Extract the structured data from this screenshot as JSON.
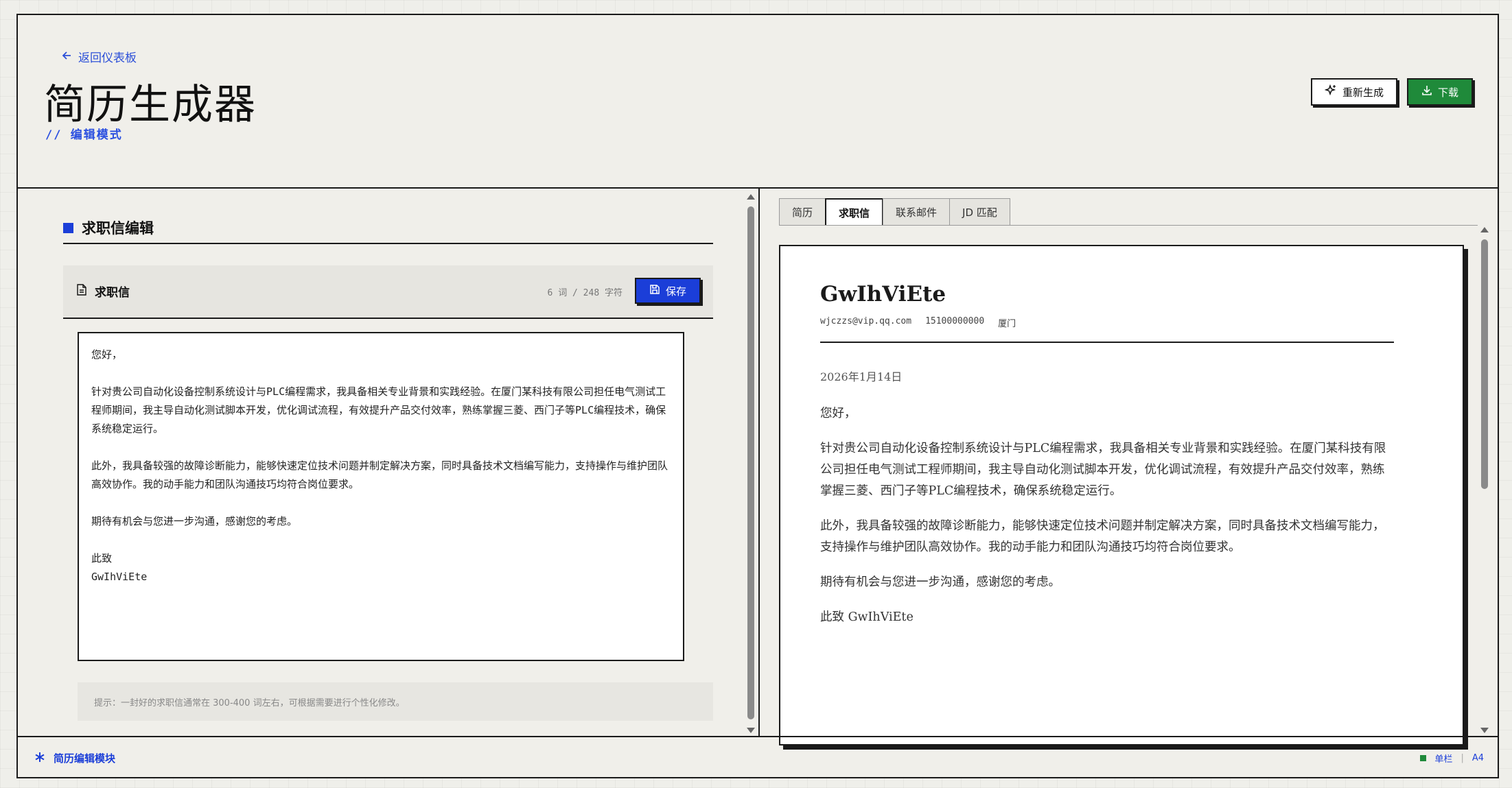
{
  "header": {
    "back_label": "返回仪表板",
    "title": "简历生成器",
    "subtitle": "// 编辑模式",
    "regen_label": "重新生成",
    "download_label": "下载"
  },
  "editor": {
    "section_title": "求职信编辑",
    "toolbar_label": "求职信",
    "count": "6 词 / 248 字符",
    "save_label": "保存",
    "lines": {
      "greeting": "您好，",
      "p1": "针对贵公司自动化设备控制系统设计与PLC编程需求，我具备相关专业背景和实践经验。在厦门某科技有限公司担任电气测试工程师期间，我主导自动化测试脚本开发，优化调试流程，有效提升产品交付效率，熟练掌握三菱、西门子等PLC编程技术，确保系统稳定运行。",
      "p2": "此外，我具备较强的故障诊断能力，能够快速定位技术问题并制定解决方案，同时具备技术文档编写能力，支持操作与维护团队高效协作。我的动手能力和团队沟通技巧均符合岗位要求。",
      "p3": "期待有机会与您进一步沟通，感谢您的考虑。",
      "closing": "此致",
      "signature": "GwIhViEte"
    },
    "hint": "提示：一封好的求职信通常在 300-400 词左右，可根据需要进行个性化修改。"
  },
  "tabs": [
    "简历",
    "求职信",
    "联系邮件",
    "JD 匹配"
  ],
  "preview": {
    "name": "GwIhViEte",
    "email": "wjczzs@vip.qq.com",
    "phone": "15100000000",
    "city": "厦门",
    "date": "2026年1月14日",
    "greeting": "您好，",
    "p1": "针对贵公司自动化设备控制系统设计与PLC编程需求，我具备相关专业背景和实践经验。在厦门某科技有限公司担任电气测试工程师期间，我主导自动化测试脚本开发，优化调试流程，有效提升产品交付效率，熟练掌握三菱、西门子等PLC编程技术，确保系统稳定运行。",
    "p2": "此外，我具备较强的故障诊断能力，能够快速定位技术问题并制定解决方案，同时具备技术文档编写能力，支持操作与维护团队高效协作。我的动手能力和团队沟通技巧均符合岗位要求。",
    "p3": "期待有机会与您进一步沟通，感谢您的考虑。",
    "closing": "此致 GwIhViEte"
  },
  "footer": {
    "module_label": "简历编辑模块",
    "layout_label": "单栏",
    "paper_label": "A4"
  },
  "colors": {
    "accent": "#1b3ed8",
    "download": "#1f8a3a",
    "border": "#1a1a1a",
    "background": "#f0efea"
  }
}
